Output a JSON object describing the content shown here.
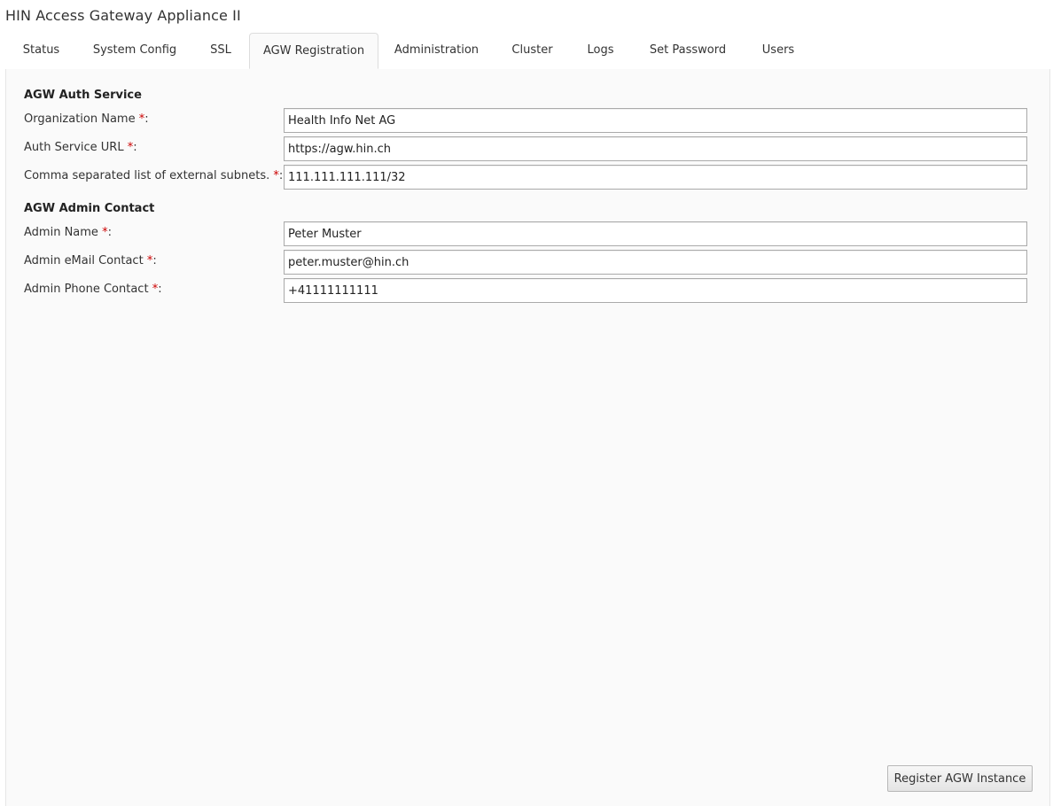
{
  "app": {
    "title": "HIN Access Gateway Appliance II"
  },
  "tabs": [
    {
      "label": "Status"
    },
    {
      "label": "System Config"
    },
    {
      "label": "SSL"
    },
    {
      "label": "AGW Registration"
    },
    {
      "label": "Administration"
    },
    {
      "label": "Cluster"
    },
    {
      "label": "Logs"
    },
    {
      "label": "Set Password"
    },
    {
      "label": "Users"
    }
  ],
  "active_tab": "AGW Registration",
  "auth_service": {
    "title": "AGW Auth Service",
    "org_name": {
      "label": "Organization Name ",
      "required": "*",
      "colon": ":",
      "value": "Health Info Net AG"
    },
    "service_url": {
      "label": "Auth Service URL ",
      "required": "*",
      "colon": ":",
      "value": "https://agw.hin.ch"
    },
    "subnets": {
      "label": "Comma separated list of external subnets. ",
      "required": "*",
      "colon": ":",
      "value": "111.111.111.111/32"
    }
  },
  "admin_contact": {
    "title": "AGW Admin Contact",
    "name": {
      "label": "Admin Name ",
      "required": "*",
      "colon": ":",
      "value": "Peter Muster"
    },
    "email": {
      "label": "Admin eMail Contact ",
      "required": "*",
      "colon": ":",
      "value": "peter.muster@hin.ch"
    },
    "phone": {
      "label": "Admin Phone Contact ",
      "required": "*",
      "colon": ":",
      "value": "+41111111111"
    }
  },
  "actions": {
    "register_label": "Register AGW Instance"
  },
  "colors": {
    "required": "#cc0000",
    "panel_bg": "#fafafa",
    "border": "#dddddd"
  }
}
